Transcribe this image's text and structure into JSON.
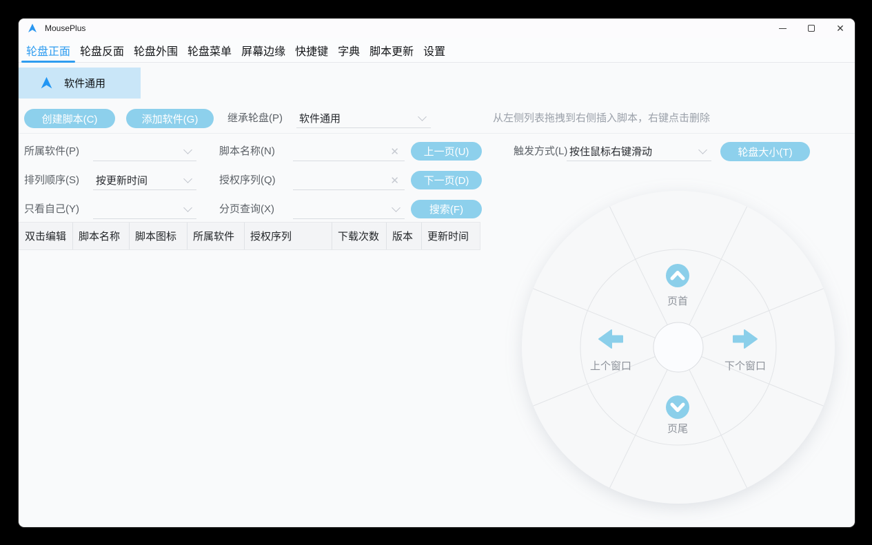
{
  "window": {
    "title": "MousePlus"
  },
  "icons": {
    "close_glyph": "✕"
  },
  "tabs": [
    {
      "label": "轮盘正面",
      "active": true
    },
    {
      "label": "轮盘反面",
      "active": false
    },
    {
      "label": "轮盘外围",
      "active": false
    },
    {
      "label": "轮盘菜单",
      "active": false
    },
    {
      "label": "屏幕边缘",
      "active": false
    },
    {
      "label": "快捷键",
      "active": false
    },
    {
      "label": "字典",
      "active": false
    },
    {
      "label": "脚本更新",
      "active": false
    },
    {
      "label": "设置",
      "active": false
    }
  ],
  "app_selector": {
    "label": "软件通用"
  },
  "toolbar": {
    "create_script": "创建脚本(C)",
    "add_software": "添加软件(G)",
    "inherit_label": "继承轮盘(P)",
    "inherit_value": "软件通用",
    "hint": "从左侧列表拖拽到右侧插入脚本，右键点击删除"
  },
  "filters": {
    "owner_software": {
      "label": "所属软件(P)",
      "value": ""
    },
    "script_name": {
      "label": "脚本名称(N)",
      "value": ""
    },
    "sort_order": {
      "label": "排列顺序(S)",
      "value": "按更新时间"
    },
    "auth_serial": {
      "label": "授权序列(Q)",
      "value": ""
    },
    "only_mine": {
      "label": "只看自己(Y)",
      "value": ""
    },
    "page_query": {
      "label": "分页查询(X)",
      "value": ""
    },
    "prev_page": "上一页(U)",
    "next_page": "下一页(D)",
    "search": "搜索(F)",
    "trigger": {
      "label": "触发方式(L)",
      "value": "按住鼠标右键滑动"
    },
    "wheel_size": "轮盘大小(T)"
  },
  "table": {
    "columns": [
      "双击编辑",
      "脚本名称",
      "脚本图标",
      "所属软件",
      "授权序列",
      "下载次数",
      "版本",
      "更新时间"
    ],
    "rows": []
  },
  "wheel": {
    "top": {
      "label": "页首"
    },
    "left": {
      "label": "上个窗口"
    },
    "right": {
      "label": "下个窗口"
    },
    "bottom": {
      "label": "页尾"
    }
  },
  "colors": {
    "accent_blue": "#2e9cf0",
    "button_blue": "#8dd0ec",
    "selection_blue": "#c9e6f8",
    "wheel_icon_blue": "#8bcfea"
  }
}
